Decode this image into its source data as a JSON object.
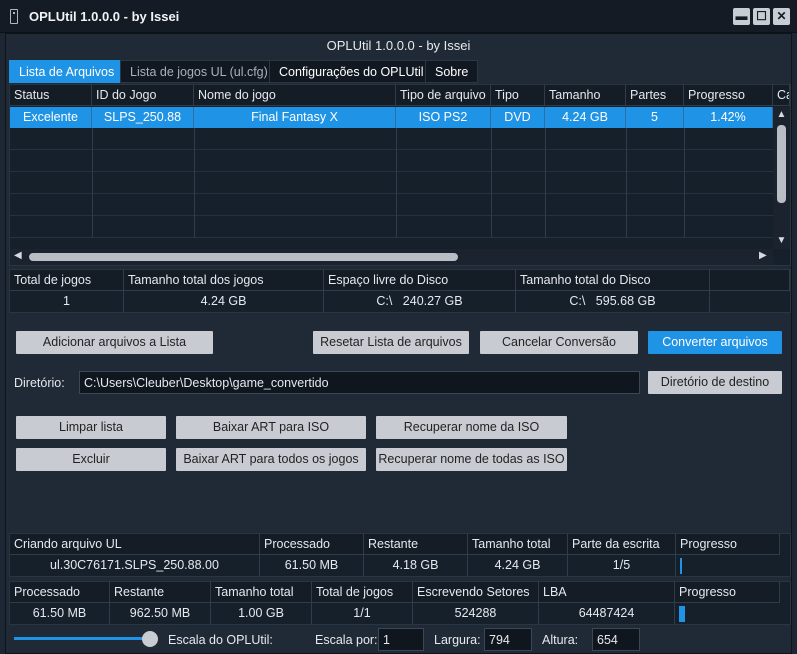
{
  "window": {
    "title": "OPLUtil 1.0.0.0 - by Issei",
    "subtitle": "OPLUtil 1.0.0.0 - by Issei",
    "controls": {
      "minimize": "▬",
      "maximize": "☐",
      "close": "✕"
    }
  },
  "tabs": [
    {
      "label": "Lista de Arquivos",
      "active": true
    },
    {
      "label": "Lista de jogos UL (ul.cfg)",
      "active": false
    },
    {
      "label": "Configurações do OPLUtil",
      "active": false
    },
    {
      "label": "Sobre",
      "active": false
    }
  ],
  "file_table": {
    "columns": [
      "Status",
      "ID do Jogo",
      "Nome do jogo",
      "Tipo de arquivo",
      "Tipo",
      "Tamanho",
      "Partes",
      "Progresso",
      "Ca"
    ],
    "rows": [
      [
        "Excelente",
        "SLPS_250.88",
        "Final Fantasy X",
        "ISO PS2",
        "DVD",
        "4.24 GB",
        "5",
        "1.42%"
      ]
    ]
  },
  "summary": {
    "headers": [
      "Total de jogos",
      "Tamanho total dos jogos",
      "Espaço livre do Disco",
      "Tamanho total do Disco"
    ],
    "values": [
      "1",
      "4.24 GB",
      "C:\\   240.27 GB",
      "C:\\   595.68 GB"
    ]
  },
  "buttons": {
    "add_files": "Adicionar arquivos a Lista",
    "reset_list": "Resetar Lista de arquivos",
    "cancel_conversion": "Cancelar Conversão",
    "convert_files": "Converter arquivos",
    "dest_dir": "Diretório de destino",
    "clear_list": "Limpar lista",
    "download_art": "Baixar ART para ISO",
    "recover_iso_name": "Recuperar nome da ISO",
    "delete": "Excluir",
    "download_art_all": "Baixar ART para todos os jogos",
    "recover_all_names": "Recuperar nome de todas as ISO"
  },
  "directory": {
    "label": "Diretório:",
    "value": "C:\\Users\\Cleuber\\Desktop\\game_convertido"
  },
  "ul_status": {
    "headers": [
      "Criando arquivo UL",
      "Processado",
      "Restante",
      "Tamanho total",
      "Parte da escrita",
      "Progresso"
    ],
    "values": [
      "ul.30C76171.SLPS_250.88.00",
      "61.50 MB",
      "4.18 GB",
      "4.24 GB",
      "1/5",
      ""
    ],
    "progress": 0.01
  },
  "sector_status": {
    "headers": [
      "Processado",
      "Restante",
      "Tamanho total",
      "Total de jogos",
      "Escrevendo Setores",
      "LBA",
      "Progresso"
    ],
    "values": [
      "61.50 MB",
      "962.50 MB",
      "1.00 GB",
      "1/1",
      "524288",
      "64487424",
      ""
    ],
    "progress": 0.06
  },
  "footer": {
    "scale_label": "Escala do OPLUtil:",
    "scale_by_label": "Escala por:",
    "scale_by_value": "1",
    "width_label": "Largura:",
    "width_value": "794",
    "height_label": "Altura:",
    "height_value": "654",
    "slider_value": 1.0
  }
}
